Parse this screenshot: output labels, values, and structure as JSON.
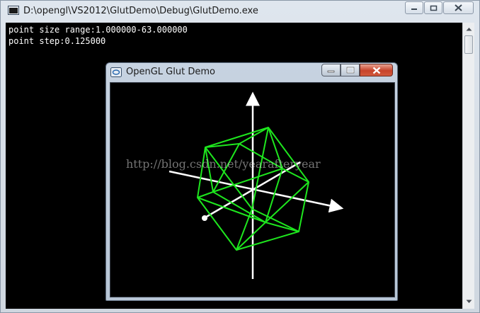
{
  "console": {
    "title": "D:\\opengl\\VS2012\\GlutDemo\\Debug\\GlutDemo.exe",
    "lines": [
      "point size range:1.000000-63.000000",
      "point step:0.125000"
    ]
  },
  "gl_window": {
    "title": "OpenGL Glut Demo"
  },
  "watermark": "http://blog.csdn.net/yearafteryear",
  "colors": {
    "wireframe": "#1ee61e",
    "axes": "#ffffff",
    "background": "#000000"
  }
}
